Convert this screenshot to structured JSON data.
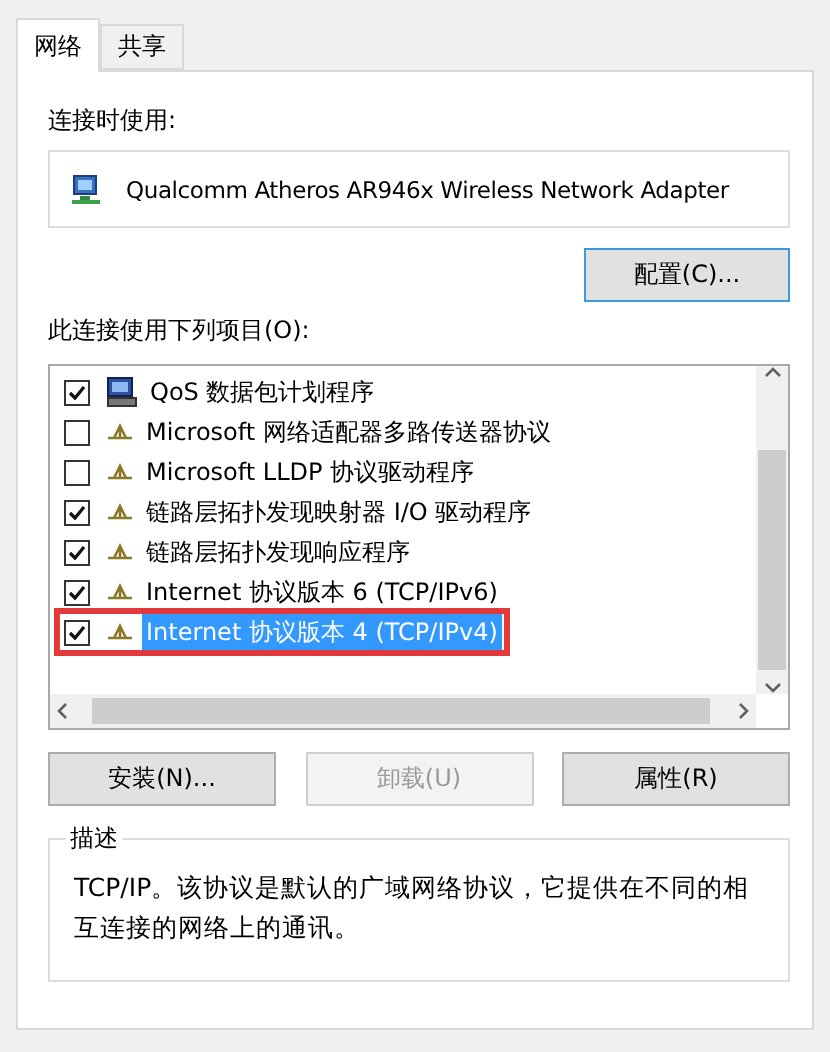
{
  "tabs": [
    {
      "label": "网络",
      "selected": true
    },
    {
      "label": "共享",
      "selected": false
    }
  ],
  "adapter_label": "连接时使用:",
  "adapter": "Qualcomm Atheros AR946x Wireless Network Adapter",
  "configure_button": "配置(C)...",
  "items_label": "此连接使用下列项目(O):",
  "items": [
    {
      "kind": "service",
      "label": "QoS 数据包计划程序",
      "checked": true,
      "selected": false,
      "highlighted": false
    },
    {
      "kind": "protocol",
      "label": "Microsoft 网络适配器多路传送器协议",
      "checked": false,
      "selected": false,
      "highlighted": false
    },
    {
      "kind": "protocol",
      "label": "Microsoft LLDP 协议驱动程序",
      "checked": false,
      "selected": false,
      "highlighted": false
    },
    {
      "kind": "protocol",
      "label": "链路层拓扑发现映射器 I/O 驱动程序",
      "checked": true,
      "selected": false,
      "highlighted": false
    },
    {
      "kind": "protocol",
      "label": "链路层拓扑发现响应程序",
      "checked": true,
      "selected": false,
      "highlighted": false
    },
    {
      "kind": "protocol",
      "label": "Internet 协议版本 6 (TCP/IPv6)",
      "checked": true,
      "selected": false,
      "highlighted": false
    },
    {
      "kind": "protocol",
      "label": "Internet 协议版本 4 (TCP/IPv4)",
      "checked": true,
      "selected": true,
      "highlighted": true
    }
  ],
  "buttons": [
    {
      "label": "安装(N)...",
      "disabled": false
    },
    {
      "label": "卸载(U)",
      "disabled": true
    },
    {
      "label": "属性(R)",
      "disabled": false
    }
  ],
  "description": {
    "title": "描述",
    "text": "TCP/IP。该协议是默认的广域网络协议，它提供在不同的相互连接的网络上的通讯。"
  }
}
